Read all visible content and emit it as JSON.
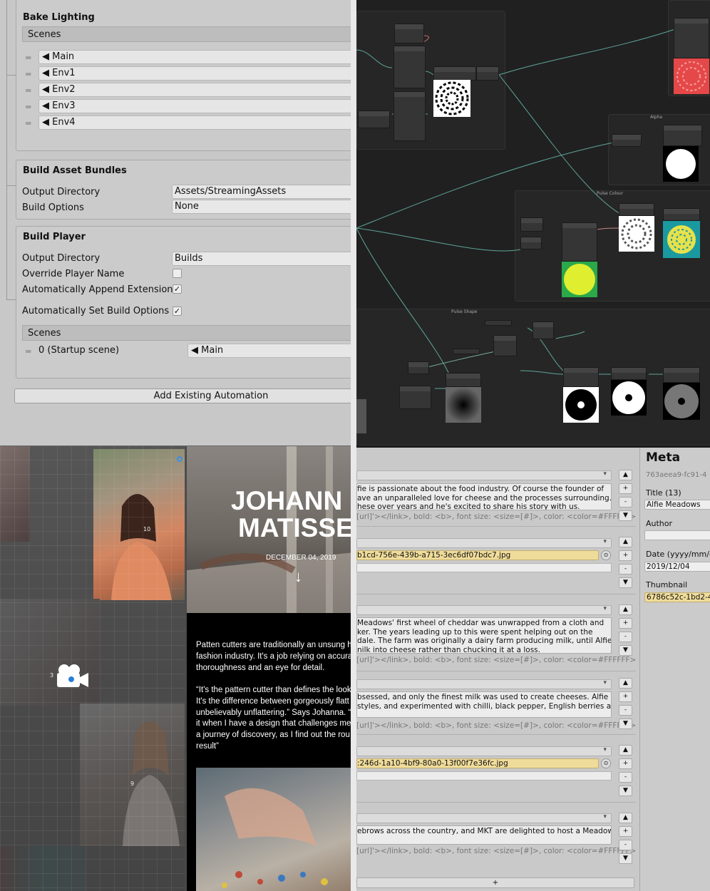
{
  "inspector": {
    "bake_lighting": {
      "title": "Bake Lighting",
      "scenes_header": "Scenes",
      "scenes": [
        "Main",
        "Env1",
        "Env2",
        "Env3",
        "Env4"
      ]
    },
    "build_asset_bundles": {
      "title": "Build Asset Bundles",
      "output_directory_label": "Output Directory",
      "output_directory_value": "Assets/StreamingAssets",
      "build_options_label": "Build Options",
      "build_options_value": "None"
    },
    "build_player": {
      "title": "Build Player",
      "output_directory_label": "Output Directory",
      "output_directory_value": "Builds",
      "override_name_label": "Override Player Name",
      "override_name_checked": false,
      "append_extension_label": "Automatically Append Extension",
      "append_extension_checked": true,
      "set_build_options_label": "Automatically Set Build Options",
      "set_build_options_checked": true,
      "scenes_header": "Scenes",
      "scene_index": "0 (Startup scene)",
      "scene_name": "Main",
      "check_glyph": "✓"
    },
    "add_button": "Add Existing Automation"
  },
  "shader_graph": {
    "group_titles": [
      "Alpha",
      "Pulse Colour",
      "Pulse Shape"
    ],
    "edge_color": "#5fa59a"
  },
  "scene_view": {
    "labels": [
      "10",
      "3",
      "9"
    ],
    "camera_icon": "camera-icon"
  },
  "article": {
    "title_line1": "JOHANN",
    "title_line2": "MATISSE",
    "date": "DECEMBER 04, 2019",
    "arrow": "↓",
    "paragraph1": [
      "Patten cutters are traditionally an unsung h",
      "fashion industry. It's a job relying on accura",
      "thoroughness and an eye for detail."
    ],
    "paragraph2": [
      "“It's the pattern cutter than defines the look",
      "It's the difference between gorgeously flatt",
      "unbelievably unflattering.” Says Johanna. “",
      "it when I have a design that challenges me",
      "a journey of discovery, as I find out the rou",
      "result”"
    ]
  },
  "editor": {
    "help_text": "[url]'></link>, bold: <b>, font size: <size=[#]>, color: <color=#FFFFFF>",
    "blocks": [
      {
        "text": [
          "fie is passionate about the food industry. Of course the founder of",
          "ave an unparalleled love for cheese and the processes surrounding.",
          "hese over years and he's excited to share his story with us."
        ]
      },
      {
        "file": "b1cd-756e-439b-a715-3ec6df07bdc7.jpg"
      },
      {
        "text": [
          " Meadows' first wheel of cheddar was unwrapped from a cloth and",
          "ker. The years leading up to this were spent helping out on the",
          "dale. The farm was originally a dairy farm producing milk, until Alfie",
          "nilk into cheese rather than chucking it at a loss."
        ]
      },
      {
        "text": [
          "bsessed, and only the finest milk was used to create cheeses. Alfie",
          "styles, and experimented with chilli, black pepper, English berries and"
        ]
      },
      {
        "file": ":246d-1a10-4bf9-80a0-13f00f7e36fc.jpg"
      },
      {
        "text": [
          "ebrows across the country, and MKT are delighted to host a Meadows'"
        ]
      }
    ],
    "controls": [
      "▲",
      "+",
      "-",
      "▼"
    ],
    "add_label": "+",
    "meta": {
      "heading": "Meta",
      "guid": "763aeea9-fc91-4",
      "title_label": "Title (13)",
      "title_value": "Alfie Meadows",
      "author_label": "Author",
      "author_value": "",
      "date_label": "Date (yyyy/mm/dd",
      "date_value": "2019/12/04",
      "thumb_label": "Thumbnail",
      "thumb_value": "6786c52c-1bd2-4"
    }
  }
}
